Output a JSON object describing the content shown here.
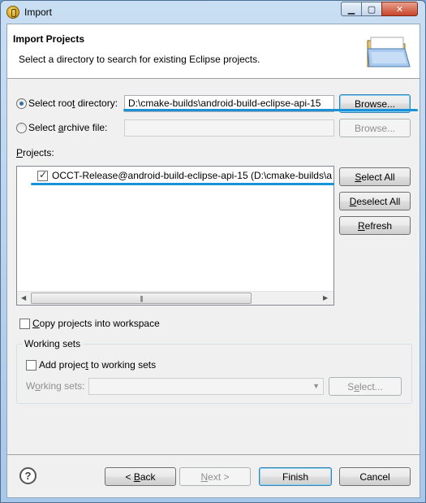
{
  "window": {
    "title": "Import"
  },
  "header": {
    "title": "Import Projects",
    "description": "Select a directory to search for existing Eclipse projects."
  },
  "root_dir": {
    "label": "Select root directory:",
    "value": "D:\\cmake-builds\\android-build-eclipse-api-15",
    "browse": "Browse...",
    "selected": true
  },
  "archive": {
    "label": "Select archive file:",
    "value": "",
    "browse": "Browse...",
    "selected": false
  },
  "projects": {
    "label": "Projects:",
    "items": [
      {
        "label": "OCCT-Release@android-build-eclipse-api-15 (D:\\cmake-builds\\a",
        "checked": true
      }
    ],
    "select_all": "Select All",
    "deselect_all": "Deselect All",
    "refresh": "Refresh",
    "scroll_thumb": "|||"
  },
  "copy_projects": {
    "label": "Copy projects into workspace",
    "checked": false
  },
  "working_sets": {
    "group_title": "Working sets",
    "add_label": "Add project to working sets",
    "add_checked": false,
    "sets_label": "Working sets:",
    "select_button": "Select..."
  },
  "footer": {
    "back": "< Back",
    "next": "Next >",
    "finish": "Finish",
    "cancel": "Cancel"
  },
  "colors": {
    "highlight_line": "#1a92d8"
  }
}
